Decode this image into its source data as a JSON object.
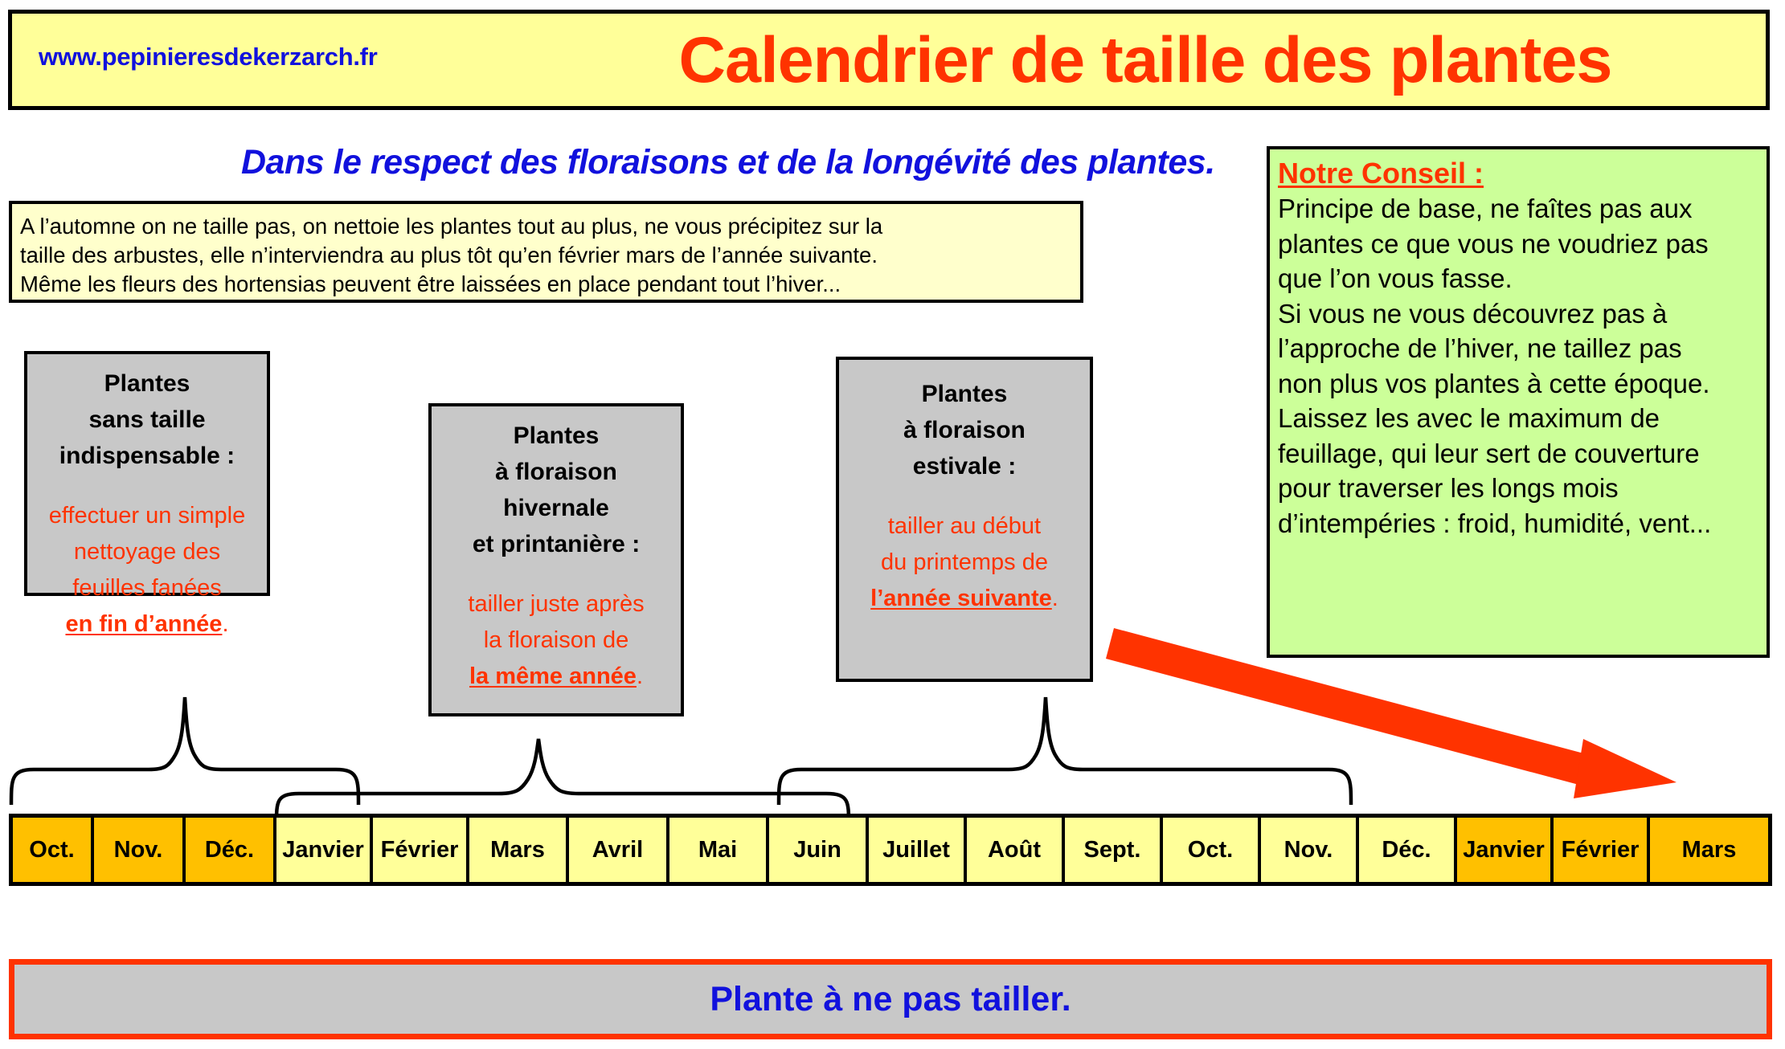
{
  "header": {
    "site_url": "www.pepinieresdekerzarch.fr",
    "title": "Calendrier de taille des plantes",
    "title_color": "#ff3300",
    "banner_bg": "#ffff99"
  },
  "subtitle": "Dans le respect des floraisons et de la longévité des plantes.",
  "autumn_note": {
    "line1": "A l’automne on ne taille pas, on nettoie les plantes tout au plus, ne vous précipitez sur la",
    "line2": "taille des arbustes, elle n’interviendra au plus tôt qu’en février mars de l’année suivante.",
    "line3": "Même les fleurs des hortensias peuvent être laissées en place pendant tout l’hiver..."
  },
  "advice": {
    "title": "Notre Conseil :",
    "lines": [
      "Principe de base, ne faîtes pas aux",
      "plantes ce que vous ne voudriez pas",
      "que l’on vous fasse.",
      "Si vous ne vous découvrez pas à",
      "l’approche de l’hiver, ne taillez pas",
      "non plus vos plantes à cette époque.",
      "Laissez les avec le maximum de",
      "feuillage, qui leur sert de couverture",
      "pour traverser  les longs mois",
      "d’intempéries : froid, humidité, vent..."
    ],
    "bg_color": "#ccff99",
    "title_color": "#ff3300"
  },
  "categories": [
    {
      "title_lines": [
        "Plantes",
        "sans taille",
        "indispensable :"
      ],
      "action_lines": [
        "effectuer un simple",
        "nettoyage des",
        "feuilles fanées"
      ],
      "action_emph": "en fin d’année",
      "action_tail": ".",
      "action_color": "#ff3300"
    },
    {
      "title_lines": [
        "Plantes",
        "à floraison",
        "hivernale",
        "et printanière :"
      ],
      "action_lines": [
        "tailler juste après",
        "la floraison de"
      ],
      "action_emph": "la même année",
      "action_tail": ".",
      "action_color": "#ff3300"
    },
    {
      "title_lines": [
        "Plantes",
        "à floraison",
        "estivale :"
      ],
      "action_lines": [
        "tailler au début",
        "du printemps de"
      ],
      "action_emph": "l’année suivante",
      "action_tail": ".",
      "action_color": "#ff3300"
    }
  ],
  "timeline": {
    "months": [
      {
        "label": "Oct.",
        "highlight": true
      },
      {
        "label": "Nov.",
        "highlight": true
      },
      {
        "label": "Déc.",
        "highlight": true
      },
      {
        "label": "Janvier",
        "highlight": false
      },
      {
        "label": "Février",
        "highlight": false
      },
      {
        "label": "Mars",
        "highlight": false
      },
      {
        "label": "Avril",
        "highlight": false
      },
      {
        "label": "Mai",
        "highlight": false
      },
      {
        "label": "Juin",
        "highlight": false
      },
      {
        "label": "Juillet",
        "highlight": false
      },
      {
        "label": "Août",
        "highlight": false
      },
      {
        "label": "Sept.",
        "highlight": false
      },
      {
        "label": "Oct.",
        "highlight": false
      },
      {
        "label": "Nov.",
        "highlight": false
      },
      {
        "label": "Déc.",
        "highlight": false
      },
      {
        "label": "Janvier",
        "highlight": true
      },
      {
        "label": "Février",
        "highlight": true
      },
      {
        "label": "Mars",
        "highlight": true
      }
    ],
    "highlight_color": "#ffc000",
    "normal_color": "#ffff99"
  },
  "footer": {
    "label": "Plante à ne pas tailler.",
    "label_color": "#1111dd",
    "border_color": "#ff3300",
    "bg_color": "#c8c8c8"
  },
  "arrow": {
    "color": "#ff3300"
  }
}
